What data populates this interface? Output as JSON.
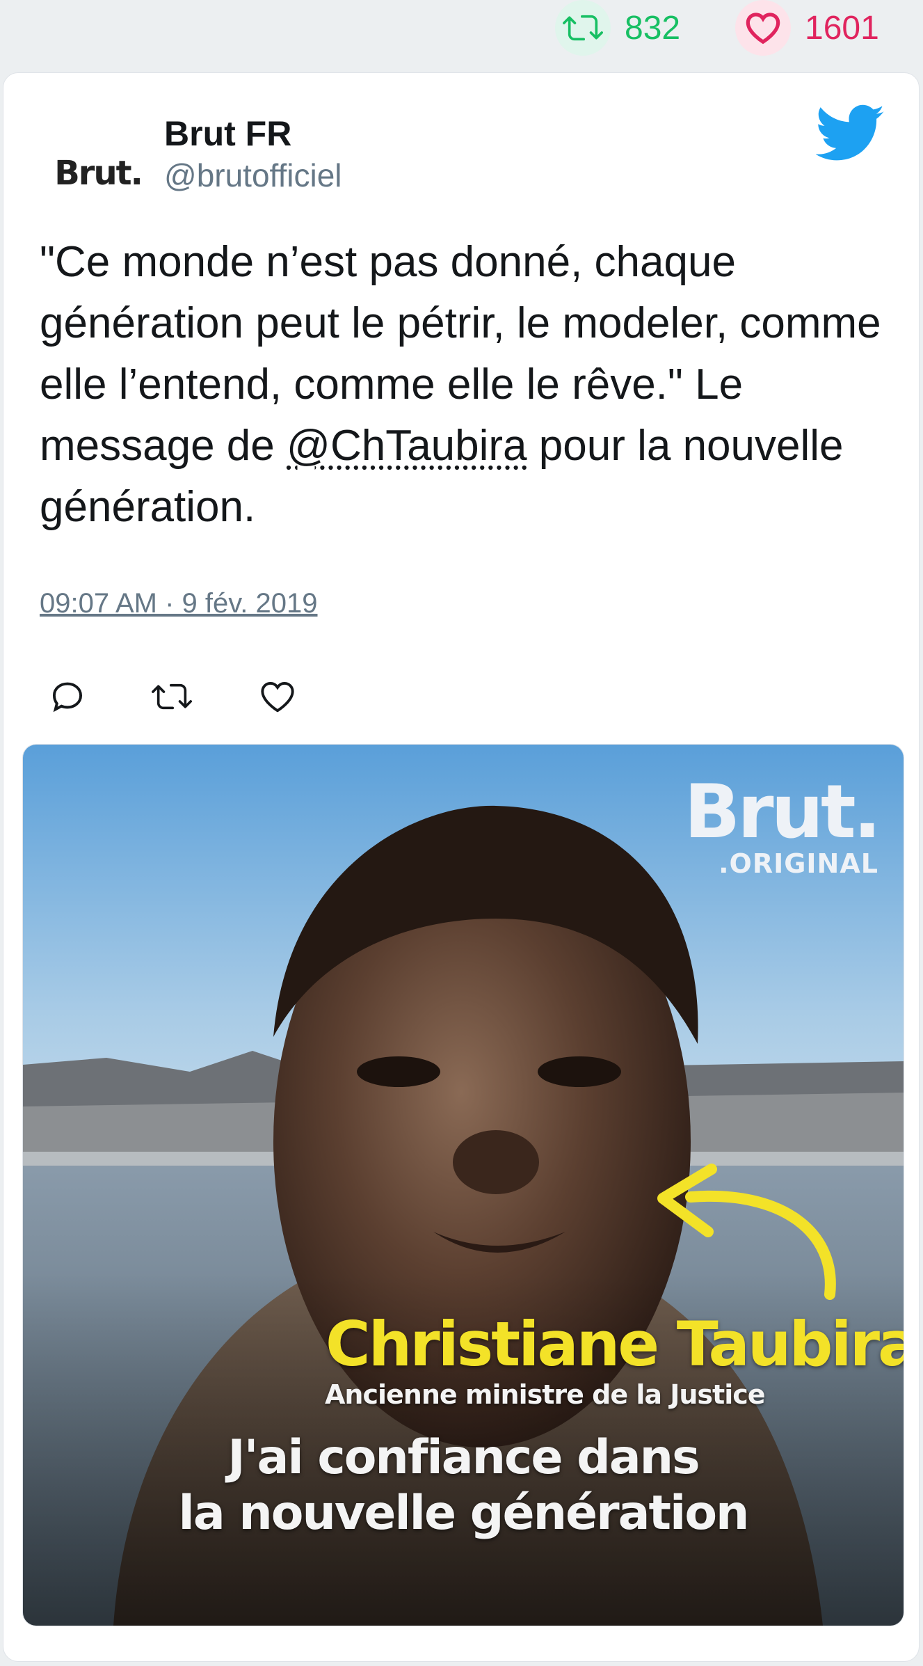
{
  "stats": {
    "retweets": "832",
    "likes": "1601"
  },
  "tweet": {
    "author_name": "Brut FR",
    "author_handle": "@brutofficiel",
    "avatar_text": "Brut.",
    "text_before": "\"Ce monde n’est pas donné, chaque génération peut le pétrir, le modeler, comme elle l’entend, comme elle le rêve.\" Le message de ",
    "mention": "@ChTaubira",
    "text_after": " pour la nouvelle génération.",
    "timestamp": "09:07 AM · 9 fév. 2019"
  },
  "media": {
    "logo": "Brut.",
    "logo_sub": ".ORIGINAL",
    "caption_name": "Christiane Taubira",
    "caption_role": "Ancienne ministre de la Justice",
    "caption_line1": "J'ai confiance dans",
    "caption_line2": "la nouvelle génération"
  },
  "icons": [
    "retweet-icon",
    "heart-icon",
    "twitter-bird-icon",
    "reply-icon"
  ],
  "colors": {
    "retweet": "#17bf63",
    "like": "#e0245e",
    "twitter_blue": "#1da1f2",
    "caption_yellow": "#f3e228"
  }
}
